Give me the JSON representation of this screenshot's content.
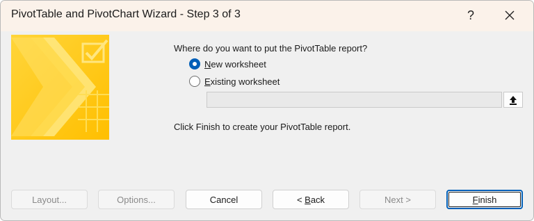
{
  "window": {
    "title": "PivotTable and PivotChart Wizard - Step 3 of 3",
    "help_label": "?"
  },
  "content": {
    "prompt": "Where do you want to put the PivotTable report?",
    "options": [
      {
        "mnemonic": "N",
        "rest": "ew worksheet",
        "selected": true
      },
      {
        "mnemonic": "E",
        "rest": "xisting worksheet",
        "selected": false
      }
    ],
    "location_value": "",
    "hint": "Click Finish to create your PivotTable report."
  },
  "buttons": {
    "layout": "Layout...",
    "options": "Options...",
    "cancel": "Cancel",
    "back_prefix": "< ",
    "back_mnemonic": "B",
    "back_rest": "ack",
    "next": "Next >",
    "finish_mnemonic": "F",
    "finish_rest": "inish"
  },
  "colors": {
    "accent": "#005fb8",
    "titlebar": "#fbf2ea",
    "dialog_bg": "#f0f0f0",
    "wizard_yellow": "#ffcc00"
  }
}
